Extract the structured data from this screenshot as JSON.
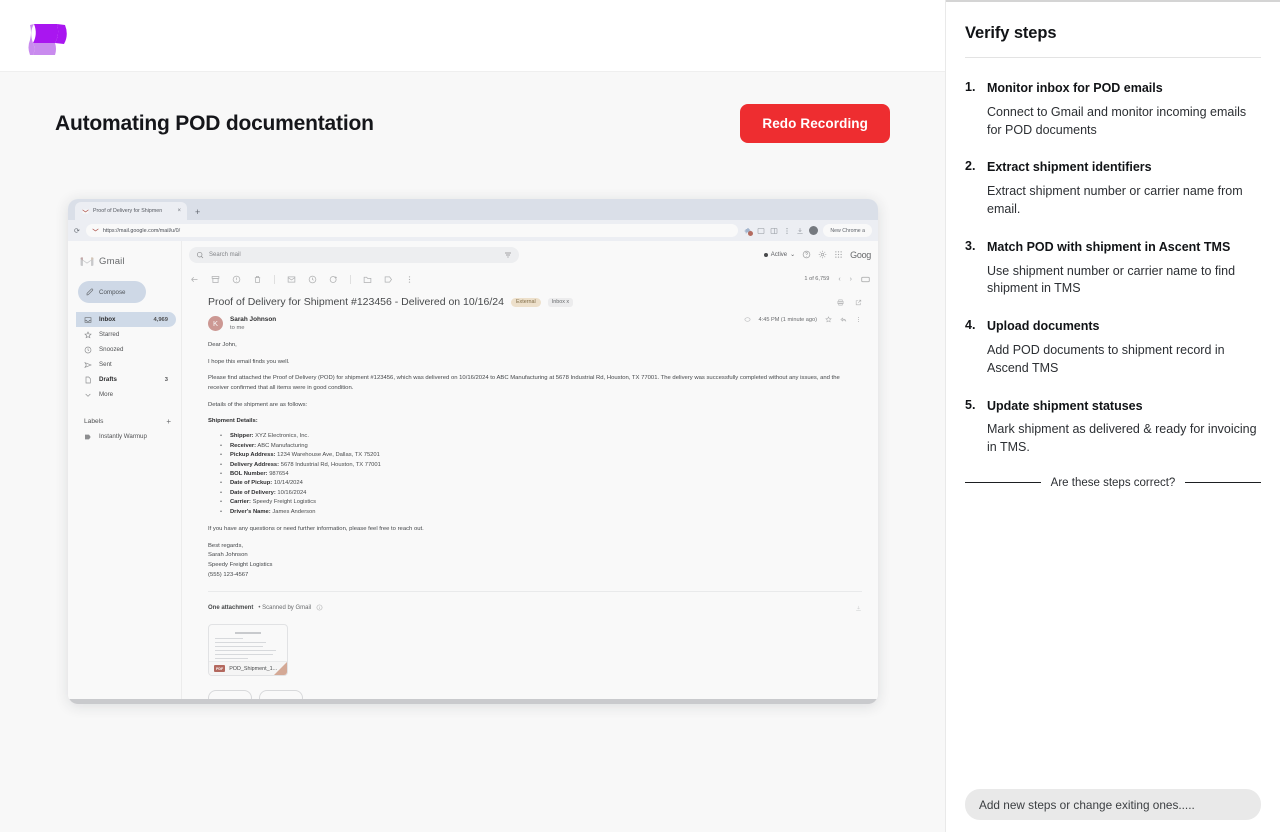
{
  "brand": {
    "logo_name": "wave-logo",
    "color_dark": "#a916f0",
    "color_light": "#c98bee"
  },
  "header": {
    "page_title": "Automating POD documentation",
    "redo_button": "Redo Recording",
    "redo_color": "#ee2d30"
  },
  "browser": {
    "tab": {
      "title": "Proof of Delivery for Shipmen",
      "close": "×"
    },
    "new_tab": "+",
    "reload": "⟳",
    "url": "https://mail.google.com/mail/u/0/",
    "chrome_pill": "New Chrome a"
  },
  "gmail": {
    "brand": "Gmail",
    "compose": "Compose",
    "nav": [
      {
        "label": "Inbox",
        "count": "4,969",
        "icon": "inbox-icon",
        "active": true
      },
      {
        "label": "Starred",
        "count": "",
        "icon": "star-icon",
        "active": false
      },
      {
        "label": "Snoozed",
        "count": "",
        "icon": "clock-icon",
        "active": false
      },
      {
        "label": "Sent",
        "count": "",
        "icon": "send-icon",
        "active": false
      },
      {
        "label": "Drafts",
        "count": "3",
        "icon": "draft-icon",
        "active": false
      },
      {
        "label": "More",
        "count": "",
        "icon": "chevron-down-icon",
        "active": false
      }
    ],
    "labels_title": "Labels",
    "labels_plus": "+",
    "label_items": [
      {
        "label": "Instantly Warmup",
        "icon": "label-icon"
      }
    ],
    "search_placeholder": "Search mail",
    "status": "Active",
    "google_text": "Goog",
    "page_count": "1 of 6,759",
    "subject": "Proof of Delivery for Shipment #123456 - Delivered on 10/16/24",
    "chip_external": "External",
    "chip_inbox": "Inbox x",
    "sender_name": "Sarah Johnson",
    "sender_to": "to me",
    "avatar_letter": "K",
    "timestamp": "4:45 PM (1 minute ago)",
    "body": {
      "greeting": "Dear John,",
      "line1": "I hope this email finds you well.",
      "line2": "Please find attached the Proof of Delivery (POD) for shipment #123456, which was delivered on 10/16/2024 to ABC Manufacturing at 5678 Industrial Rd, Houston, TX 77001. The delivery was successfully completed without any issues, and the receiver confirmed that all items were in good condition.",
      "line3": "Details of the shipment are as follows:",
      "details_heading": "Shipment Details:",
      "details": [
        {
          "label": "Shipper:",
          "value": "XYZ Electronics, Inc."
        },
        {
          "label": "Receiver:",
          "value": "ABC Manufacturing"
        },
        {
          "label": "Pickup Address:",
          "value": "1234 Warehouse Ave, Dallas, TX 75201"
        },
        {
          "label": "Delivery Address:",
          "value": "5678 Industrial Rd, Houston, TX 77001"
        },
        {
          "label": "BOL Number:",
          "value": "987654"
        },
        {
          "label": "Date of Pickup:",
          "value": "10/14/2024"
        },
        {
          "label": "Date of Delivery:",
          "value": "10/16/2024"
        },
        {
          "label": "Carrier:",
          "value": "Speedy Freight Logistics"
        },
        {
          "label": "Driver's Name:",
          "value": "James Anderson"
        }
      ],
      "closing": "If you have any questions or need further information, please feel free to reach out.",
      "sign1": "Best regards,",
      "sign2": "Sarah Johnson",
      "sign3": "Speedy Freight Logistics",
      "sign4": "(555) 123-4567"
    },
    "attachment": {
      "title": "One attachment",
      "sub": "• Scanned by Gmail",
      "pdf_badge": "PDF",
      "file_name": "POD_Shipment_1...",
      "preview_title": "Proof of Delivery (POD)"
    }
  },
  "verify_panel": {
    "title": "Verify steps",
    "steps": [
      {
        "num": "1.",
        "title": "Monitor inbox for POD emails",
        "desc": "Connect to Gmail and monitor incoming emails for POD documents"
      },
      {
        "num": "2.",
        "title": "Extract shipment identifiers",
        "desc": "Extract shipment number or carrier name from email."
      },
      {
        "num": "3.",
        "title": "Match POD with shipment in Ascent TMS",
        "desc": "Use shipment number or carrier name to find shipment in TMS"
      },
      {
        "num": "4.",
        "title": "Upload documents",
        "desc": "Add POD documents to shipment record in Ascend TMS"
      },
      {
        "num": "5.",
        "title": "Update shipment statuses",
        "desc": "Mark shipment as delivered & ready for invoicing in TMS."
      }
    ],
    "confirm_text": "Are these steps correct?",
    "input_placeholder": "Add new steps or change exiting ones....."
  }
}
